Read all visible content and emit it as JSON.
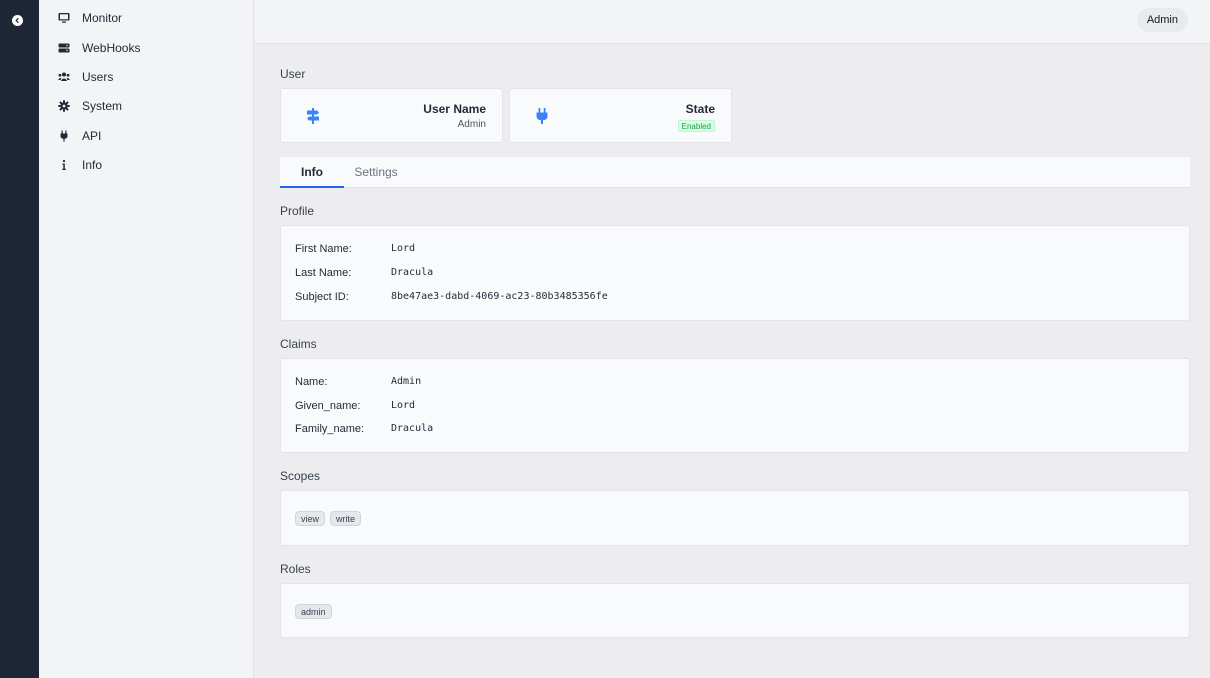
{
  "nav": {
    "items": [
      {
        "label": "Monitor",
        "icon": "monitor-icon"
      },
      {
        "label": "WebHooks",
        "icon": "server-icon"
      },
      {
        "label": "Users",
        "icon": "users-icon"
      },
      {
        "label": "System",
        "icon": "gear-icon"
      },
      {
        "label": "API",
        "icon": "plug-icon"
      },
      {
        "label": "Info",
        "icon": "info-icon"
      }
    ]
  },
  "header": {
    "user_button": "Admin"
  },
  "user_section": {
    "title": "User",
    "cards": [
      {
        "label": "User Name",
        "value": "Admin",
        "icon": "signpost-icon"
      },
      {
        "label": "State",
        "value": "Enabled",
        "icon": "plug-icon",
        "badge_color": "#16a34a"
      }
    ]
  },
  "tabs": [
    {
      "label": "Info",
      "active": true
    },
    {
      "label": "Settings",
      "active": false
    }
  ],
  "profile": {
    "title": "Profile",
    "rows": [
      {
        "key": "First Name:",
        "value": "Lord"
      },
      {
        "key": "Last Name:",
        "value": "Dracula"
      },
      {
        "key": "Subject ID:",
        "value": "8be47ae3-dabd-4069-ac23-80b3485356fe"
      }
    ]
  },
  "claims": {
    "title": "Claims",
    "rows": [
      {
        "key": "Name:",
        "value": "Admin"
      },
      {
        "key": "Given_name:",
        "value": "Lord"
      },
      {
        "key": "Family_name:",
        "value": "Dracula"
      }
    ]
  },
  "scopes": {
    "title": "Scopes",
    "items": [
      "view",
      "write"
    ]
  },
  "roles": {
    "title": "Roles",
    "items": [
      "admin"
    ]
  },
  "colors": {
    "accent": "#2563eb",
    "rail": "#1e2736",
    "success": "#16a34a"
  }
}
